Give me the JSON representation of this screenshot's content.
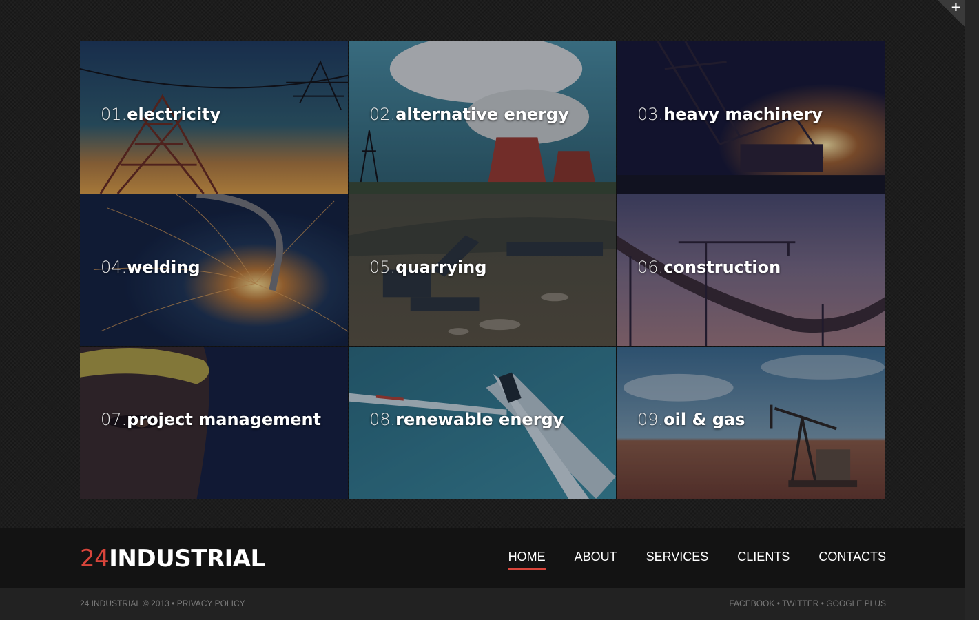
{
  "corner_toggle": {
    "icon": "plus-icon",
    "glyph": "+"
  },
  "tiles": [
    {
      "num": "01.",
      "name": "electricity"
    },
    {
      "num": "02.",
      "name": "alternative energy"
    },
    {
      "num": "03.",
      "name": "heavy machinery"
    },
    {
      "num": "04.",
      "name": "welding"
    },
    {
      "num": "05.",
      "name": "quarrying"
    },
    {
      "num": "06.",
      "name": "construction"
    },
    {
      "num": "07.",
      "name": "project management"
    },
    {
      "num": "08.",
      "name": "renewable energy"
    },
    {
      "num": "09.",
      "name": "oil & gas"
    }
  ],
  "logo": {
    "number": "24",
    "word": "INDUSTRIAL"
  },
  "nav": {
    "items": [
      {
        "label": "HOME",
        "active": true
      },
      {
        "label": "ABOUT",
        "active": false
      },
      {
        "label": "SERVICES",
        "active": false
      },
      {
        "label": "CLIENTS",
        "active": false
      },
      {
        "label": "CONTACTS",
        "active": false
      }
    ]
  },
  "footer": {
    "copyright": "24 INDUSTRIAL © 2013",
    "separator": "•",
    "privacy": "PRIVACY POLICY",
    "social": [
      "FACEBOOK",
      "TWITTER",
      "GOOGLE PLUS"
    ]
  },
  "colors": {
    "accent": "#d9453b",
    "background": "#1c1c1c",
    "footer_nav": "#131313",
    "footer_bottom": "#222222"
  }
}
